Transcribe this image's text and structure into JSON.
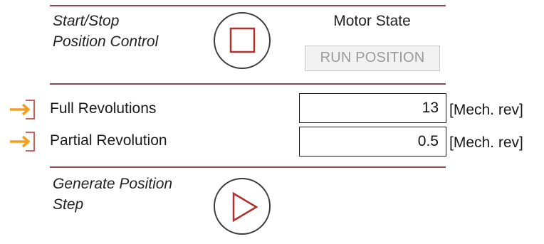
{
  "position_control": {
    "label": "Start/Stop\nPosition Control",
    "button_icon": "stop-square-icon",
    "accent_color": "#b0302c"
  },
  "motor_state": {
    "title": "Motor State",
    "value": "RUN POSITION"
  },
  "fields": [
    {
      "label": "Full Revolutions",
      "value": "13",
      "unit": "[Mech. rev]",
      "icon": "input-arrow-icon"
    },
    {
      "label": "Partial Revolution",
      "value": "0.5",
      "unit": "[Mech. rev]",
      "icon": "input-arrow-icon"
    }
  ],
  "generate_step": {
    "label": "Generate Position\nStep",
    "button_icon": "play-triangle-icon"
  },
  "colors": {
    "divider": "#8a4a52",
    "input_icon": "#f0a020",
    "input_icon_outline": "#c0504d"
  }
}
